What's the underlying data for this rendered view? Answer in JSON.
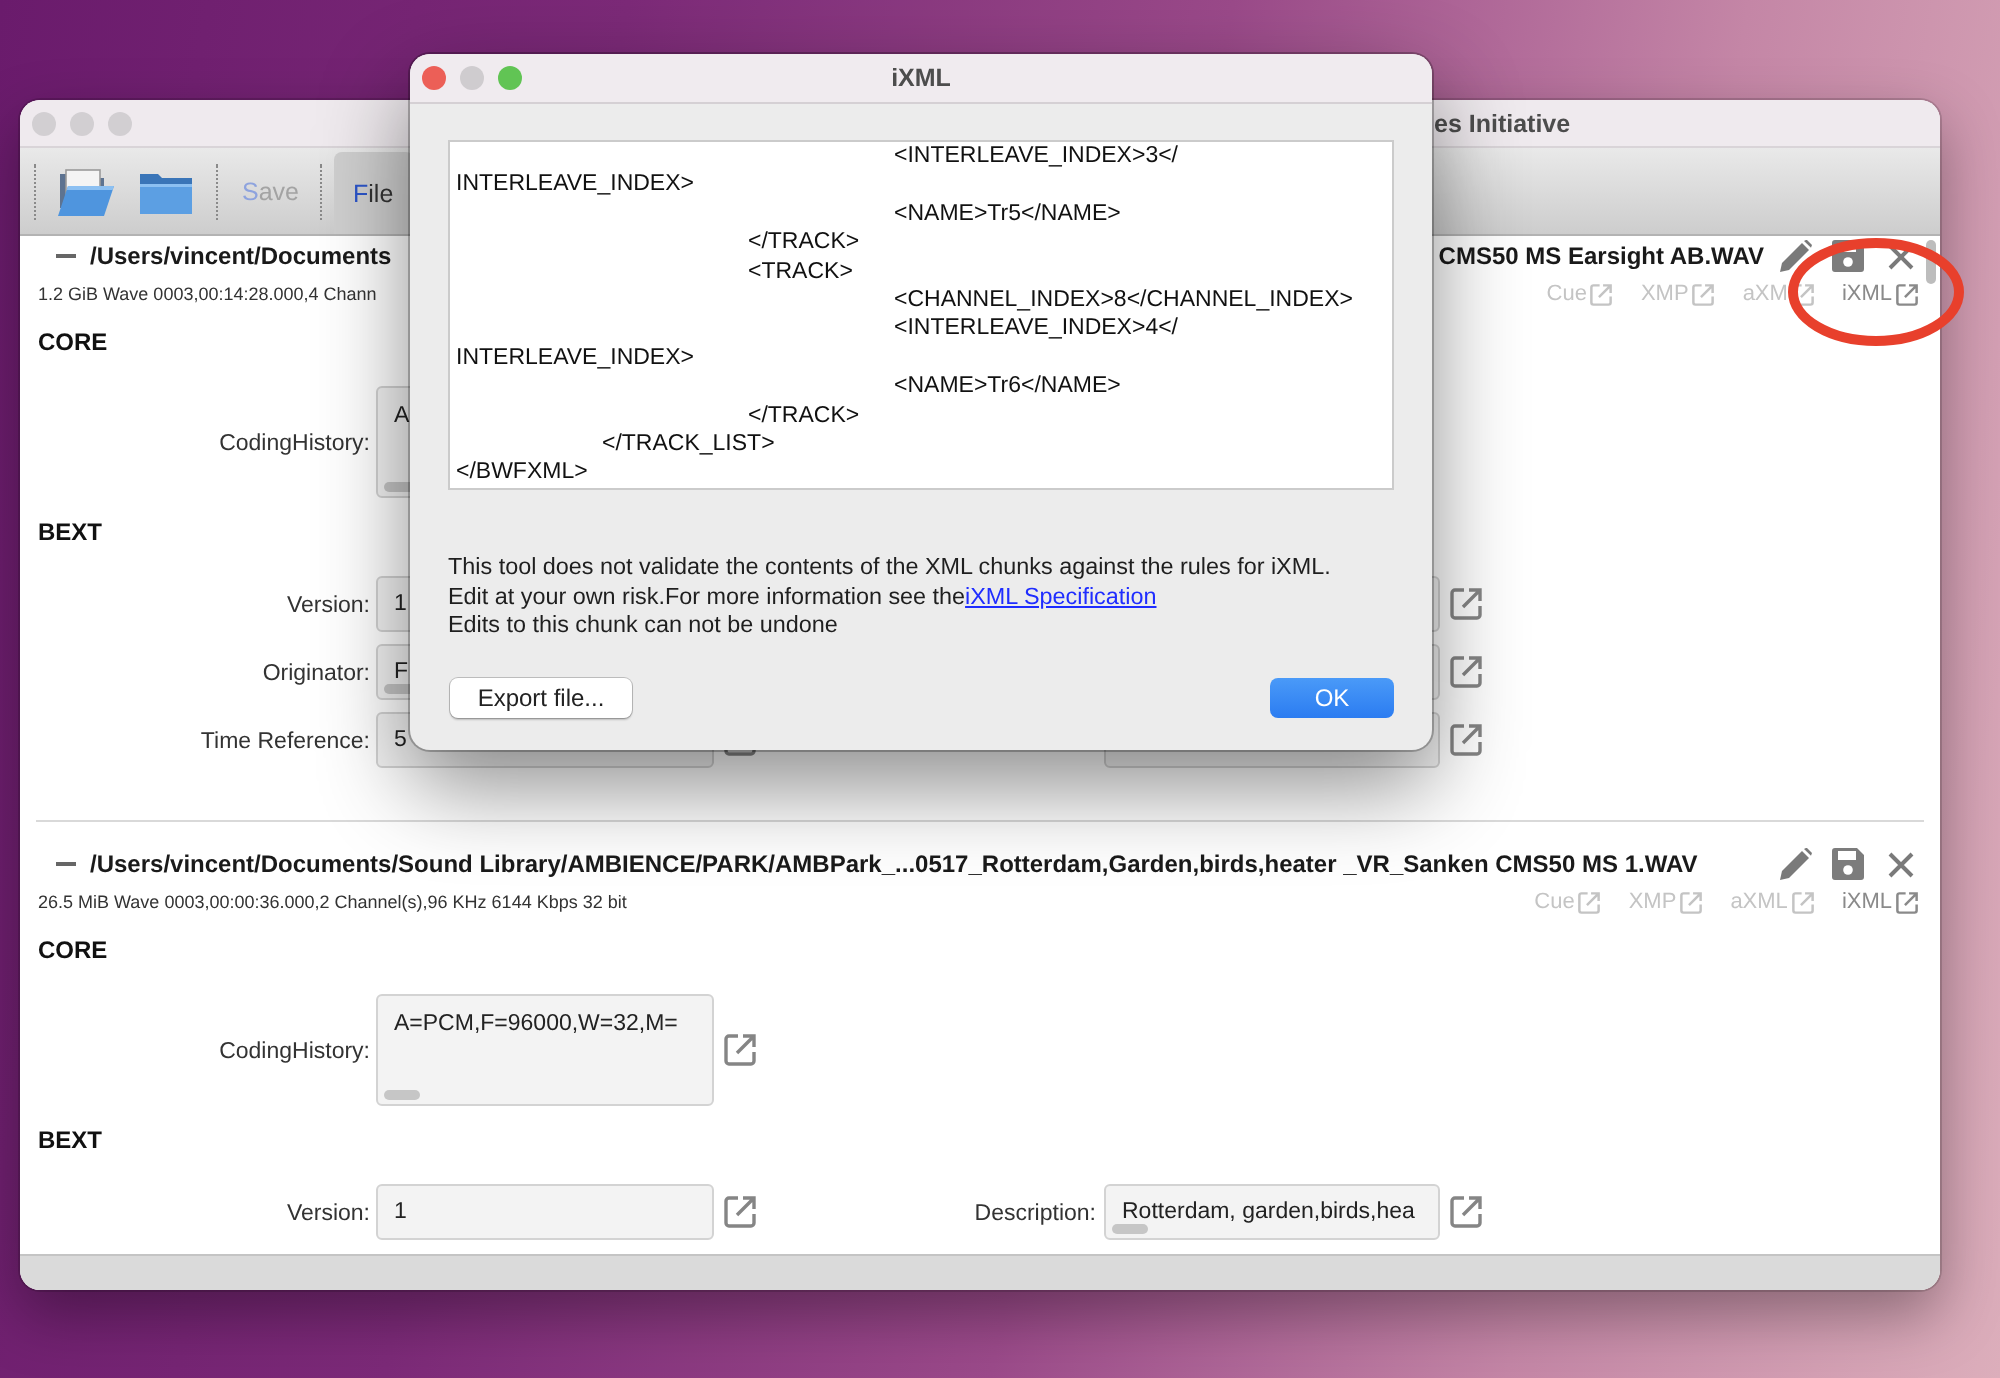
{
  "main_window": {
    "title": "es Initiative",
    "active": false,
    "toolbar": {
      "buttons": [
        {
          "kind": "open-folder",
          "disabled": false
        },
        {
          "kind": "folder",
          "disabled": false
        },
        {
          "kind": "text",
          "label": "Save",
          "disabled": true
        }
      ],
      "tabs": [
        {
          "label": "File",
          "selected": true
        }
      ]
    },
    "files": [
      {
        "expanded": true,
        "path_parts": [
          "/Users/vincent/Documents",
          "CMS50 MS Earsight AB.WAV"
        ],
        "info": "1.2 GiB Wave 0003,00:14:28.000,4 Chann",
        "chunks": [
          {
            "label": "Cue",
            "disabled": true,
            "circled": false
          },
          {
            "label": "XMP",
            "disabled": true,
            "circled": false
          },
          {
            "label": "aXM",
            "disabled": true,
            "circled": false
          },
          {
            "label": "iXML",
            "disabled": false,
            "circled": true
          }
        ],
        "groups": [
          {
            "title": "CORE",
            "rows": [
              {
                "cells": [
                  {
                    "kind": "multiline",
                    "label": "CodingHistory:",
                    "value": "A",
                    "scrollbar": true
                  }
                ]
              }
            ]
          },
          {
            "title": "BEXT",
            "rows": [
              {
                "cells": [
                  {
                    "kind": "line",
                    "label": "Version:",
                    "value": "1",
                    "scrollbar": false
                  },
                  {
                    "kind": "line"
                  }
                ]
              },
              {
                "cells": [
                  {
                    "kind": "line",
                    "label": "Originator:",
                    "value": "F",
                    "scrollbar": true
                  },
                  {
                    "kind": "line"
                  }
                ]
              },
              {
                "cells": [
                  {
                    "kind": "line",
                    "label": "Time Reference:",
                    "value": "5",
                    "scrollbar": false
                  },
                  {
                    "kind": "line"
                  }
                ]
              }
            ]
          }
        ]
      },
      {
        "expanded": true,
        "path_parts": [
          "/Users/vincent/Documents/Sound Library/AMBIENCE/PARK/AMBPark_...0517_Rotterdam,Garden,birds,heater _VR_Sanken CMS50 MS 1.WAV"
        ],
        "info": "26.5 MiB Wave 0003,00:00:36.000,2 Channel(s),96 KHz 6144 Kbps 32 bit",
        "chunks": [
          {
            "label": "Cue",
            "disabled": true,
            "circled": false
          },
          {
            "label": "XMP",
            "disabled": true,
            "circled": false
          },
          {
            "label": "aXML",
            "disabled": true,
            "circled": false
          },
          {
            "label": "iXML",
            "disabled": false,
            "circled": false
          }
        ],
        "groups": [
          {
            "title": "CORE",
            "rows": [
              {
                "cells": [
                  {
                    "kind": "multiline",
                    "label": "CodingHistory:",
                    "value": "A=PCM,F=96000,W=32,M=",
                    "scrollbar": true
                  }
                ]
              }
            ]
          },
          {
            "title": "BEXT",
            "rows": [
              {
                "cells": [
                  {
                    "kind": "line",
                    "label": "Version:",
                    "value": "1",
                    "scrollbar": false
                  },
                  {
                    "kind": "line",
                    "label": "Description:",
                    "value": "Rotterdam, garden,birds,hea",
                    "scrollbar": true
                  }
                ]
              }
            ]
          }
        ]
      }
    ]
  },
  "dialog": {
    "title": "iXML",
    "active": true,
    "xml_text": "\t\t\t<INTERLEAVE_INDEX>3</\nINTERLEAVE_INDEX>\n\t\t\t<NAME>Tr5</NAME>\n\t\t</TRACK>\n\t\t<TRACK>\n\t\t\t<CHANNEL_INDEX>8</CHANNEL_INDEX>\n\t\t\t<INTERLEAVE_INDEX>4</\nINTERLEAVE_INDEX>\n\t\t\t<NAME>Tr6</NAME>\n\t\t</TRACK>\n\t</TRACK_LIST>\n</BWFXML>",
    "notice": [
      {
        "text": "This tool does not validate the contents of the XML chunks against the rules for iXML."
      },
      {
        "text": "Edit at your own risk.For more information see the",
        "link": "iXML Specification"
      },
      {
        "text": "Edits to this chunk can not be undone"
      }
    ],
    "buttons": [
      {
        "label": "Export file...",
        "kind": "default"
      },
      {
        "label": "OK",
        "kind": "primary"
      }
    ]
  }
}
